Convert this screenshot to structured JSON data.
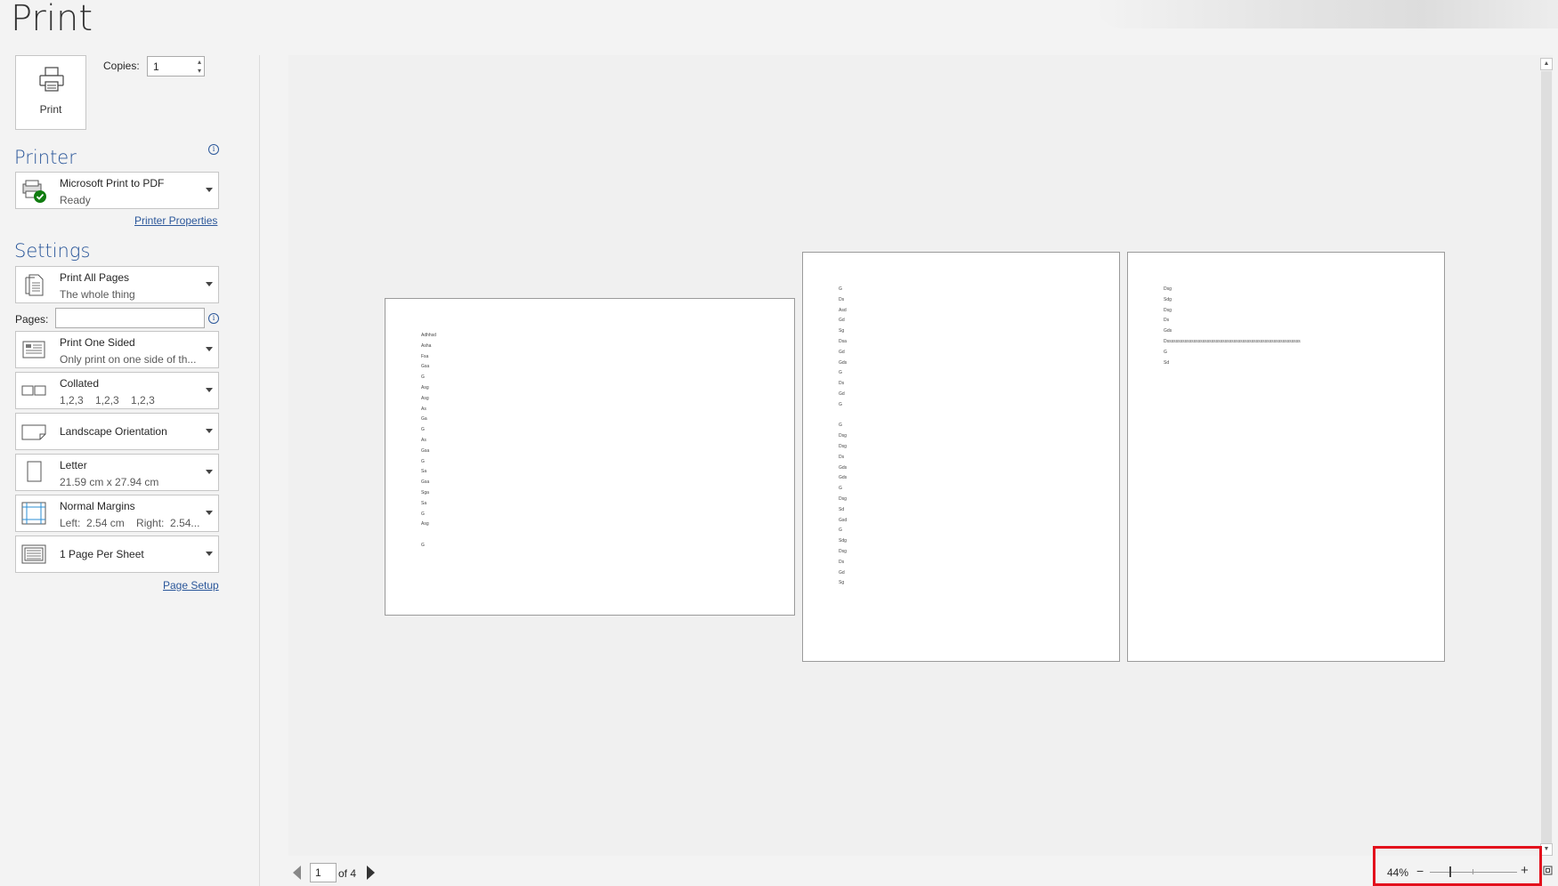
{
  "header": {
    "title": "Print"
  },
  "print_button": {
    "label": "Print"
  },
  "copies": {
    "label": "Copies:",
    "value": "1"
  },
  "printer": {
    "heading": "Printer",
    "name": "Microsoft Print to PDF",
    "status": "Ready",
    "properties_link": "Printer Properties"
  },
  "settings": {
    "heading": "Settings",
    "pages_label": "Pages:",
    "pages_value": "",
    "items": [
      {
        "l1": "Print All Pages",
        "l2": "The whole thing",
        "icon": "pages-icon"
      },
      {
        "l1": "Print One Sided",
        "l2": "Only print on one side of th...",
        "icon": "one-sided-icon"
      },
      {
        "l1": "Collated",
        "l2": "1,2,3    1,2,3    1,2,3",
        "icon": "collated-icon"
      },
      {
        "l1": "Landscape Orientation",
        "icon": "landscape-icon"
      },
      {
        "l1": "Letter",
        "l2": "21.59 cm x 27.94 cm",
        "icon": "paper-size-icon"
      },
      {
        "l1": "Normal Margins",
        "l2": "Left:  2.54 cm    Right:  2.54...",
        "icon": "margins-icon"
      },
      {
        "l1": "1 Page Per Sheet",
        "icon": "pages-per-sheet-icon"
      }
    ],
    "page_setup_link": "Page Setup"
  },
  "preview": {
    "page1_lines": [
      "Adhhsd",
      "Ashа",
      "Fsa",
      "Gsa",
      "G",
      "Asg",
      "Asg",
      "As",
      "Ga",
      "G",
      "As",
      "Gsa",
      "G",
      "Sa",
      "Gsa",
      "Sga",
      "Sa",
      "G",
      "Asg",
      "",
      "G"
    ],
    "page2_lines": [
      "G",
      "Ds",
      "Asd",
      "Gd",
      "Sg",
      "Dsa",
      "Gd",
      "Gds",
      "G",
      "Ds",
      "Gd",
      "G",
      "",
      "G",
      "Dsg",
      "Dsg",
      "Ds",
      "Gds",
      "Gds",
      "G",
      "Dsg",
      "Sd",
      "Gsd",
      "G",
      "Sdg",
      "Dsg",
      "Ds",
      "Gd",
      "Sg"
    ],
    "page3_lines": [
      "Dsg",
      "Sdg",
      "Dsg",
      "Ds",
      "Gds",
      "Dssssssssssssssssssssssssssssssssssssssssssssssssssssssssssss",
      "G",
      "Sd"
    ]
  },
  "navigation": {
    "current_page": "1",
    "of_label": "of 4"
  },
  "zoom": {
    "percent": "44%",
    "minus": "−",
    "plus": "+",
    "level_fraction": 0.22
  },
  "colors": {
    "accent": "#2b579a",
    "highlight": "#e3101c"
  }
}
